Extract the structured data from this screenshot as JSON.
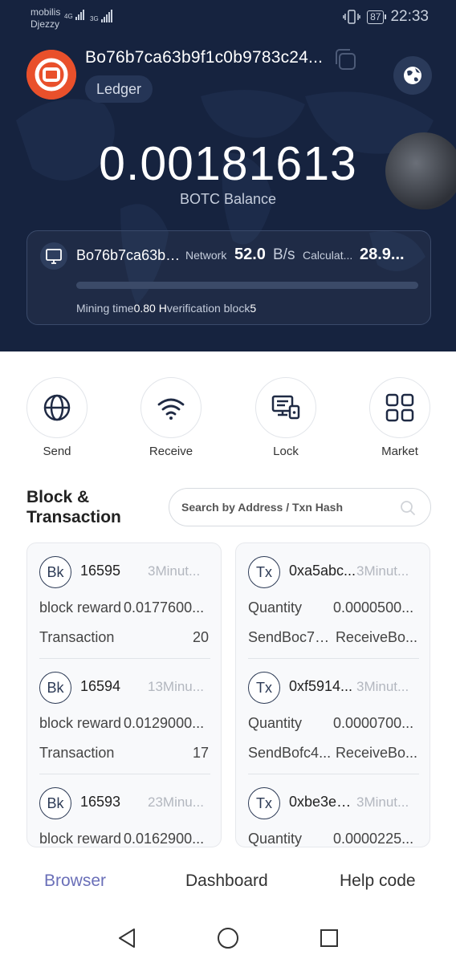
{
  "status_bar": {
    "carrier_1": "mobilis",
    "carrier_2": "Djezzy",
    "net_1": "4G",
    "net_2": "3G",
    "battery": "87",
    "time": "22:33"
  },
  "wallet": {
    "address": "Bo76b7ca63b9f1c0b9783c24...",
    "type_badge": "Ledger",
    "balance": "0.00181613",
    "balance_label": "BOTC Balance"
  },
  "mining": {
    "address": "Bo76b7ca63b9...",
    "network_label": "Network",
    "network_value": "52.0",
    "network_unit": "B/s",
    "calc_label": "Calculat...",
    "calc_value": "28.9...",
    "progress_fraction": 0,
    "mining_time_label": "Mining time",
    "mining_time_value": "0.80 H",
    "verification_label": "verification block",
    "verification_value": "5"
  },
  "actions": [
    {
      "label": "Send",
      "icon": "globe-icon"
    },
    {
      "label": "Receive",
      "icon": "wifi-icon"
    },
    {
      "label": "Lock",
      "icon": "lock-monitor-icon"
    },
    {
      "label": "Market",
      "icon": "grid-icon"
    }
  ],
  "block_section": {
    "title_line1": "Block &",
    "title_line2": "Transaction",
    "search_placeholder": "Search by Address / Txn Hash"
  },
  "blocks": [
    {
      "badge": "Bk",
      "id": "16595",
      "time": "3Minut...",
      "row1_label": "block reward",
      "row1_value": "0.0177600...",
      "row2_label": "Transaction",
      "row2_value": "20"
    },
    {
      "badge": "Bk",
      "id": "16594",
      "time": "13Minu...",
      "row1_label": "block reward",
      "row1_value": "0.0129000...",
      "row2_label": "Transaction",
      "row2_value": "17"
    },
    {
      "badge": "Bk",
      "id": "16593",
      "time": "23Minu...",
      "row1_label": "block reward",
      "row1_value": "0.0162900...",
      "row2_label": "",
      "row2_value": ""
    }
  ],
  "transactions": [
    {
      "badge": "Tx",
      "id": "0xa5abc...",
      "time": "3Minut...",
      "row1_label": "Quantity",
      "row1_value": "0.0000500...",
      "row2_label": "SendBoc77...",
      "row2_value": "ReceiveBo..."
    },
    {
      "badge": "Tx",
      "id": "0xf5914...",
      "time": "3Minut...",
      "row1_label": "Quantity",
      "row1_value": "0.0000700...",
      "row2_label": "SendBofc4...",
      "row2_value": "ReceiveBo..."
    },
    {
      "badge": "Tx",
      "id": "0xbe3e3...",
      "time": "3Minut...",
      "row1_label": "Quantity",
      "row1_value": "0.0000225...",
      "row2_label": "",
      "row2_value": ""
    }
  ],
  "tabs": [
    {
      "label": "Browser",
      "active": true
    },
    {
      "label": "Dashboard",
      "active": false
    },
    {
      "label": "Help code",
      "active": false
    }
  ],
  "colors": {
    "hero_bg": "#16233f",
    "logo": "#e9502b",
    "active_tab": "#6a6fb8"
  }
}
